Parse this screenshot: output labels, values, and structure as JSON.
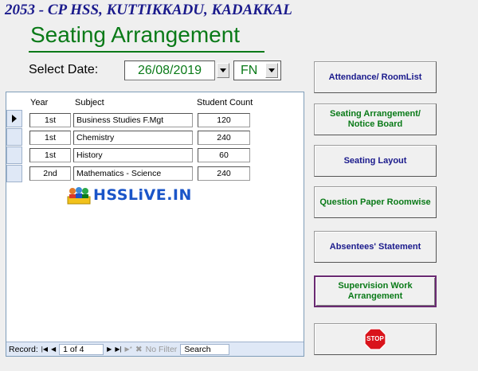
{
  "header": {
    "school_title": "2053 - CP HSS, KUTTIKKADU, KADAKKAL",
    "form_title": "Seating Arrangement"
  },
  "filters": {
    "date_label": "Select Date:",
    "date_value": "26/08/2019",
    "session_value": "FN"
  },
  "table": {
    "columns": [
      "Year",
      "Subject",
      "Student Count"
    ],
    "rows": [
      {
        "year": "1st",
        "subject": "Business Studies F.Mgt",
        "count": "120"
      },
      {
        "year": "1st",
        "subject": "Chemistry",
        "count": "240"
      },
      {
        "year": "1st",
        "subject": "History",
        "count": "60"
      },
      {
        "year": "2nd",
        "subject": "Mathematics - Science",
        "count": "240"
      }
    ]
  },
  "logo": {
    "text": "HSSLiVE.IN"
  },
  "record_nav": {
    "label": "Record:",
    "first": "|◀",
    "prev": "◀",
    "position": "1 of 4",
    "next": "▶",
    "last": "▶|",
    "new": "▶*",
    "filter_label": "No Filter",
    "search_label": "Search"
  },
  "buttons": {
    "attendance": "Attendance/ RoomList",
    "seating_notice": "Seating Arrangement/ Notice Board",
    "seating_layout": "Seating Layout",
    "question_paper": "Question Paper Roomwise",
    "absentees": "Absentees' Statement",
    "supervision": "Supervision Work Arrangement",
    "stop": "STOP"
  },
  "colors": {
    "title_blue": "#1a1a8c",
    "title_green": "#0a7a18",
    "logo_blue": "#1a55c8",
    "stop_red": "#d9141b"
  }
}
